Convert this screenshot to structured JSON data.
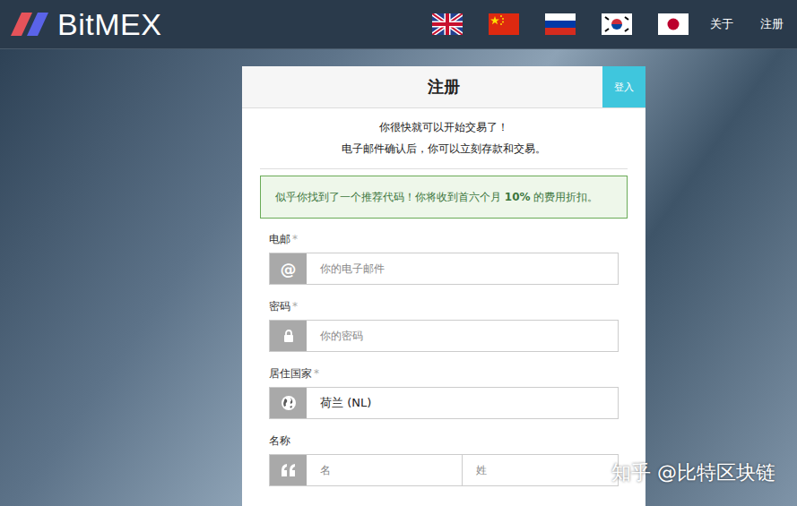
{
  "header": {
    "logo": "BitMEX",
    "nav": [
      "关于",
      "注册"
    ]
  },
  "card": {
    "title": "注册",
    "login_button": "登入",
    "intro": [
      "你很快就可以开始交易了！",
      "电子邮件确认后，你可以立刻存款和交易。"
    ],
    "notice": {
      "before": "似乎你找到了一个推荐代码！你将收到首六个月 ",
      "bold": "10%",
      "after": " 的费用折扣。"
    },
    "fields": [
      {
        "kind": "email",
        "label": "电邮",
        "required": true,
        "required_mark": "*",
        "icon": "@",
        "placeholder": "你的电子邮件"
      },
      {
        "kind": "password",
        "label": "密码",
        "required": true,
        "required_mark": "*",
        "placeholder": "你的密码"
      },
      {
        "kind": "country",
        "label": "居住国家",
        "required": true,
        "required_mark": "*",
        "value": "荷兰 (NL)"
      },
      {
        "kind": "name",
        "label": "名称",
        "required": false,
        "required_mark": "*",
        "placeholders": [
          "名",
          "姓"
        ]
      }
    ]
  },
  "watermark": "知乎 @比特区块链"
}
